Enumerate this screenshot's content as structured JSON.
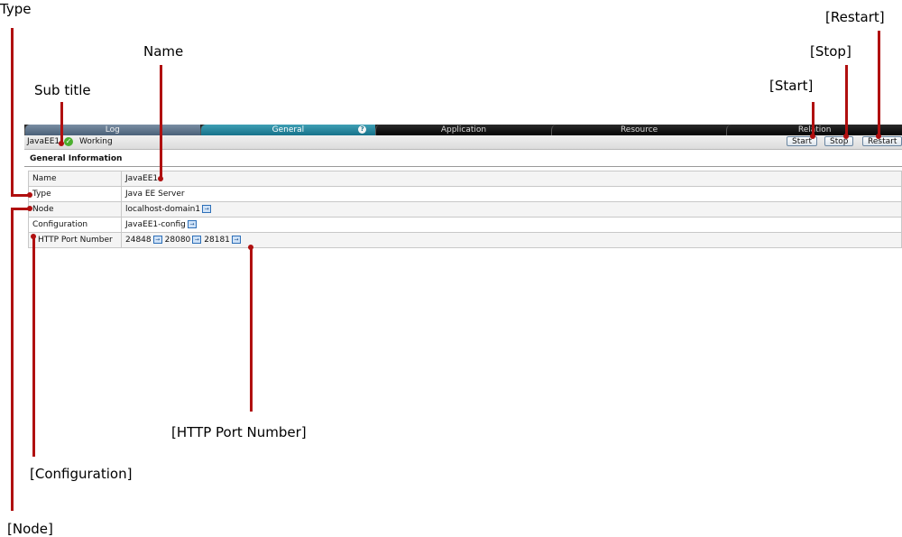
{
  "annotations": {
    "type": "Type",
    "name": "Name",
    "sub_title": "Sub title",
    "restart": "[Restart]",
    "stop": "[Stop]",
    "start": "[Start]",
    "http_port_number": "[HTTP Port Number]",
    "configuration": "[Configuration]",
    "node": "[Node]"
  },
  "tabs": [
    "Log",
    "General",
    "Application",
    "Resource",
    "Relation"
  ],
  "active_tab": "General",
  "status": {
    "server_name": "JavaEE1",
    "state": "Working",
    "buttons": {
      "start": "Start",
      "stop": "Stop",
      "restart": "Restart"
    }
  },
  "section_title": "General Information",
  "info": {
    "name": {
      "label": "Name",
      "value": "JavaEE1"
    },
    "type": {
      "label": "Type",
      "value": "Java EE Server"
    },
    "node": {
      "label": "Node",
      "value": "localhost-domain1"
    },
    "config": {
      "label": "Configuration",
      "value": "JavaEE1-config"
    },
    "ports": {
      "label": "HTTP Port Number",
      "values": [
        "24848",
        "28080",
        "28181"
      ]
    }
  },
  "icons": {
    "status_ok": "check-circle-icon",
    "link": "jump-link-icon",
    "help": "help-icon"
  },
  "colors": {
    "callout": "#b01010",
    "active_tab": "#1d7f96",
    "ok": "#4caf2f"
  }
}
